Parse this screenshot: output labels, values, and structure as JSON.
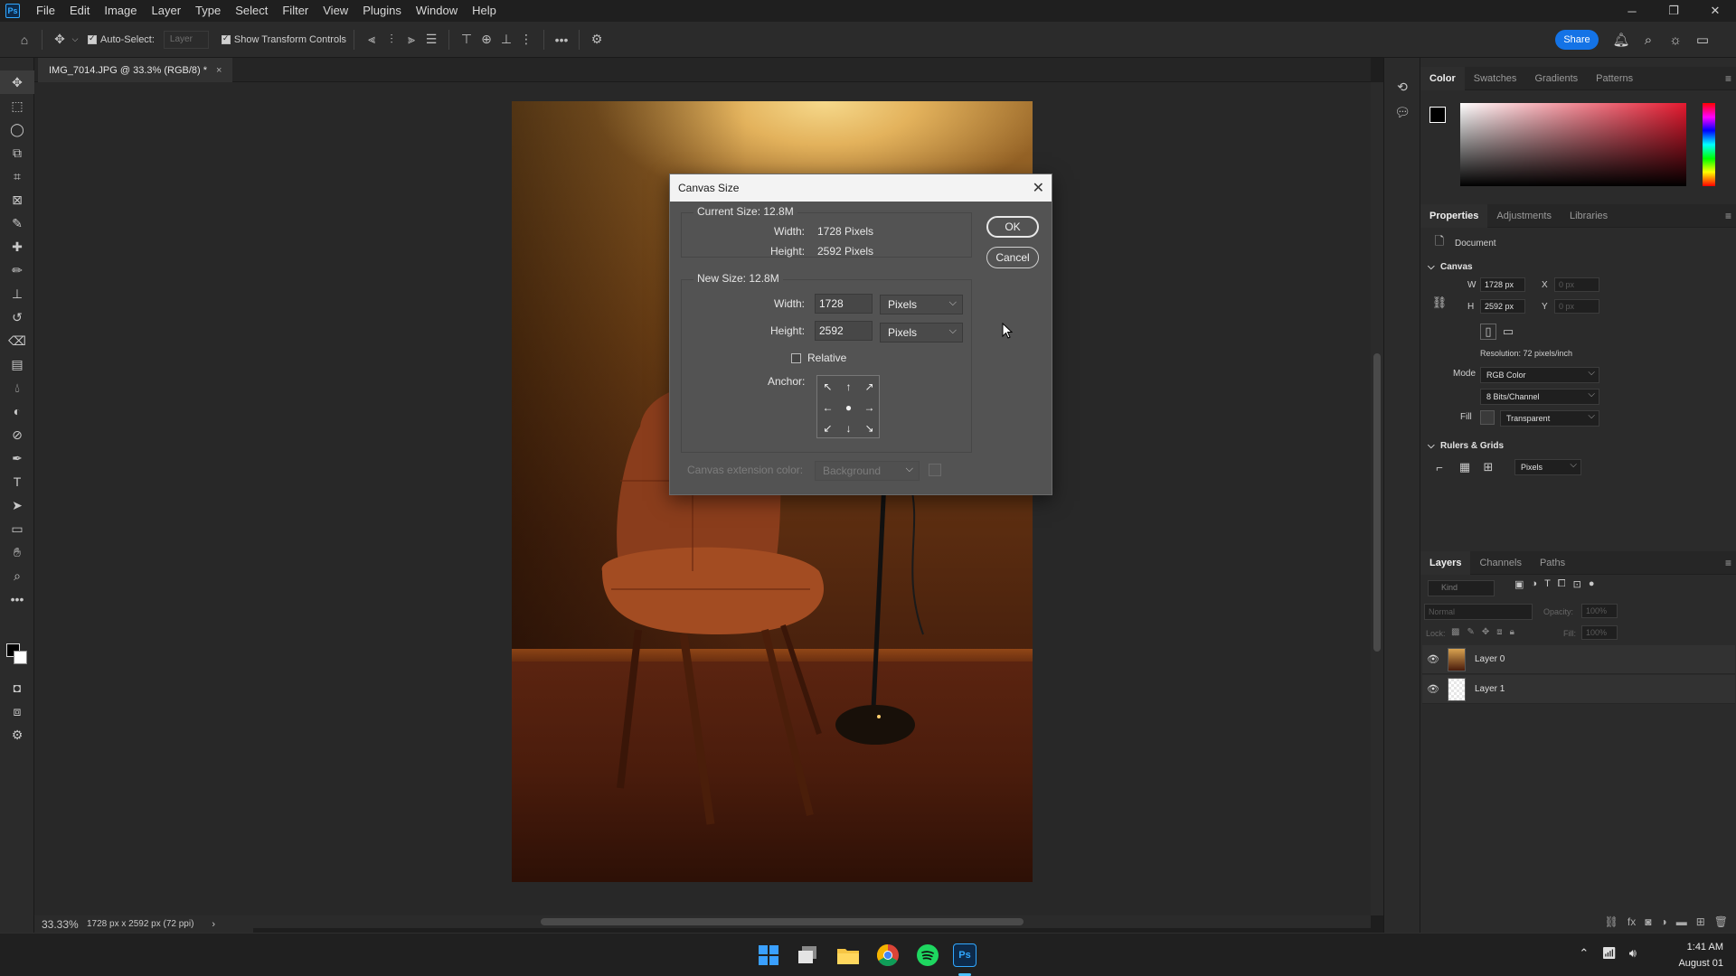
{
  "menubar": {
    "logo": "Ps",
    "items": [
      "File",
      "Edit",
      "Image",
      "Layer",
      "Type",
      "Select",
      "Filter",
      "View",
      "Plugins",
      "Window",
      "Help"
    ]
  },
  "options": {
    "auto_select_label": "Auto-Select:",
    "auto_select_target": "Layer",
    "show_transform_label": "Show Transform Controls",
    "share_label": "Share"
  },
  "document": {
    "tab_title": "IMG_7014.JPG @ 33.3% (RGB/8) *",
    "tab_close": "×"
  },
  "status": {
    "zoom": "33.33%",
    "info": "1728 px x 2592 px (72 ppi)",
    "arrow": "›"
  },
  "dialog": {
    "title": "Canvas Size",
    "close": "✕",
    "current_size_label": "Current Size: 12.8M",
    "width_label": "Width:",
    "height_label": "Height:",
    "current_width": "1728 Pixels",
    "current_height": "2592 Pixels",
    "new_size_label": "New Size: 12.8M",
    "new_width": "1728",
    "new_height": "2592",
    "unit": "Pixels",
    "relative_label": "Relative",
    "anchor_label": "Anchor:",
    "anchor_arrows": [
      "↖",
      "↑",
      "↗",
      "←",
      "●",
      "→",
      "↙",
      "↓",
      "↘"
    ],
    "extension_label": "Canvas extension color:",
    "extension_value": "Background",
    "ok_label": "OK",
    "cancel_label": "Cancel"
  },
  "panels": {
    "color_tabs": [
      "Color",
      "Swatches",
      "Gradients",
      "Patterns"
    ],
    "props_tabs": [
      "Properties",
      "Adjustments",
      "Libraries"
    ],
    "document_label": "Document",
    "canvas_section": "Canvas",
    "w_label": "W",
    "h_label": "H",
    "x_label": "X",
    "y_label": "Y",
    "w_value": "1728 px",
    "h_value": "2592 px",
    "x_value": "0 px",
    "y_value": "0 px",
    "resolution": "Resolution: 72 pixels/inch",
    "mode_label": "Mode",
    "mode_value": "RGB Color",
    "depth_value": "8 Bits/Channel",
    "fill_label": "Fill",
    "fill_value": "Transparent",
    "rulers_section": "Rulers & Grids",
    "rulers_unit": "Pixels",
    "layers_tabs": [
      "Layers",
      "Channels",
      "Paths"
    ],
    "kind_placeholder": "Kind",
    "blend_mode": "Normal",
    "opacity_label": "Opacity:",
    "opacity_value": "100%",
    "lock_label": "Lock:",
    "fill_label2": "Fill:",
    "fill_value2": "100%",
    "layers": [
      {
        "name": "Layer 0"
      },
      {
        "name": "Layer 1"
      }
    ]
  },
  "taskbar": {
    "time": "1:41 AM",
    "date": "August 01",
    "ps_label": "Ps"
  },
  "colors": {
    "accent": "#1473e6",
    "dialog_bg": "#535353",
    "panel_bg": "#2b2b2b"
  }
}
